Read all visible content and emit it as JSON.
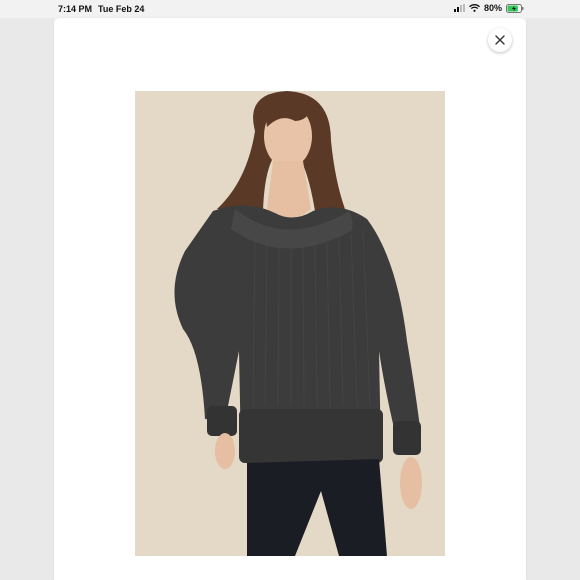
{
  "status_bar": {
    "time": "7:14 PM",
    "date": "Tue Feb 24",
    "battery_percent": "80%",
    "battery_level": 0.8
  },
  "colors": {
    "photo_background": "#e4d9c6",
    "sweater": "#3c3c3d",
    "pants": "#1b1d24",
    "battery_fill": "#34c759"
  },
  "modal": {
    "close_icon": "close-icon",
    "image_subject": "product-photo"
  }
}
